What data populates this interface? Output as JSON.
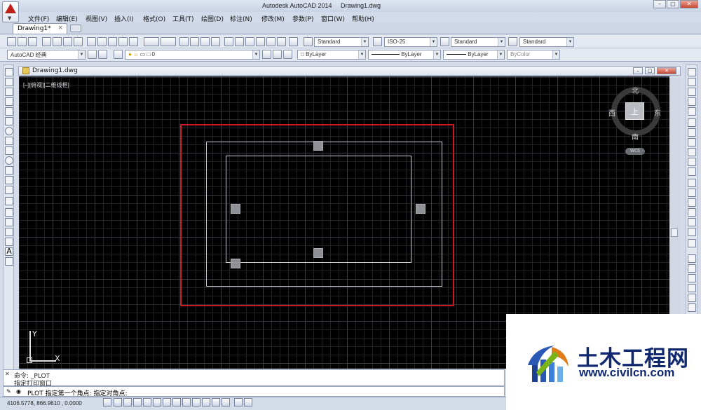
{
  "app": {
    "title": "Autodesk AutoCAD 2014",
    "file": "Drawing1.dwg",
    "window_controls": [
      "–",
      "▢",
      "✕"
    ]
  },
  "menu": [
    "文件(F)",
    "编辑(E)",
    "视图(V)",
    "插入(I)",
    "格式(O)",
    "工具(T)",
    "绘图(D)",
    "标注(N)",
    "修改(M)",
    "参数(P)",
    "窗口(W)",
    "帮助(H)"
  ],
  "tabs": {
    "active": "Drawing1*",
    "close": "×"
  },
  "toolbar": {
    "text_style": "Standard",
    "dim_style": "ISO-25",
    "table_style": "Standard",
    "mleader_style": "Standard",
    "workspace": "AutoCAD 经典",
    "layer": "0",
    "color": "ByLayer",
    "linetype": "ByLayer",
    "lineweight": "ByLayer",
    "plotstyle": "ByColor"
  },
  "document": {
    "title": "Drawing1.dwg",
    "view_label": "[–][俯视][二维线框]"
  },
  "viewcube": {
    "top": "上",
    "north": "北",
    "south": "南",
    "east": "东",
    "west": "西",
    "wcs": "WCS"
  },
  "ucs": {
    "x": "X",
    "y": "Y"
  },
  "command": {
    "history": [
      "命令:  _PLOT",
      "指定打印窗口"
    ],
    "prompt": "PLOT 指定第一个角点: 指定对角点:"
  },
  "status": {
    "coords": "4106.5778,  866.9610 ,  0.0000"
  },
  "watermark": {
    "name": "土木工程网",
    "url": "www.civilcn.com"
  },
  "colors": {
    "selection": "#d01820",
    "canvas": "#000000",
    "entity": "#cfd2d6",
    "watermark": "#0f2870"
  }
}
